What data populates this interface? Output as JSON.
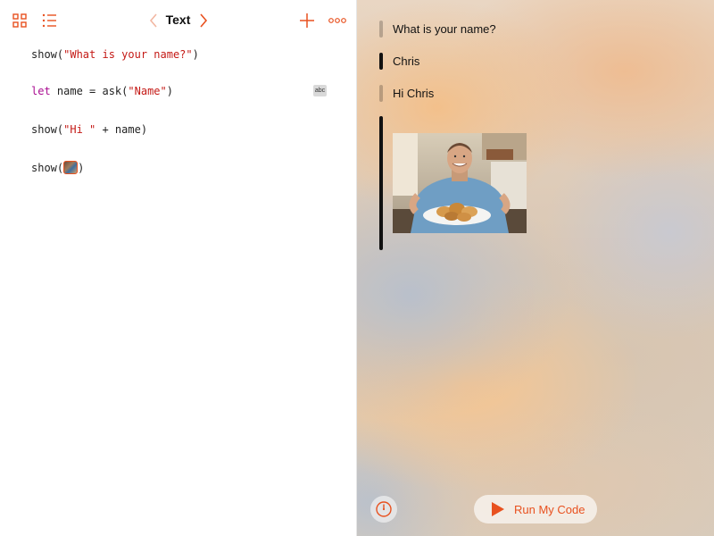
{
  "toolbar": {
    "title": "Text",
    "icons": {
      "grid": "grid-icon",
      "list": "list-icon",
      "back": "chevron-left-icon",
      "forward": "chevron-right-icon",
      "add": "plus-icon",
      "more": "more-icon"
    },
    "accent_color": "#e8511f"
  },
  "code": {
    "line1": {
      "fn": "show(",
      "str": "\"What is your name?\"",
      "close": ")"
    },
    "line2": {
      "kw": "let",
      "rest": " name = ask(",
      "str": "\"Name\"",
      "close": ")",
      "badge": "abc"
    },
    "line3": {
      "fn": "show(",
      "str": "\"Hi \"",
      "rest": " + name)"
    },
    "line4": {
      "fn": "show(",
      "close": ")",
      "image_literal": "image-literal-icon"
    },
    "colors": {
      "string": "#c41a16",
      "keyword": "#aa0d91"
    }
  },
  "live_view": {
    "outputs": [
      "What is your name?",
      "Chris",
      "Hi Chris"
    ],
    "image_output": "photo-of-man-holding-plate-of-pastries"
  },
  "bottom_bar": {
    "speed_icon": "speedometer-icon",
    "run_label": "Run My Code",
    "run_icon": "play-icon"
  }
}
